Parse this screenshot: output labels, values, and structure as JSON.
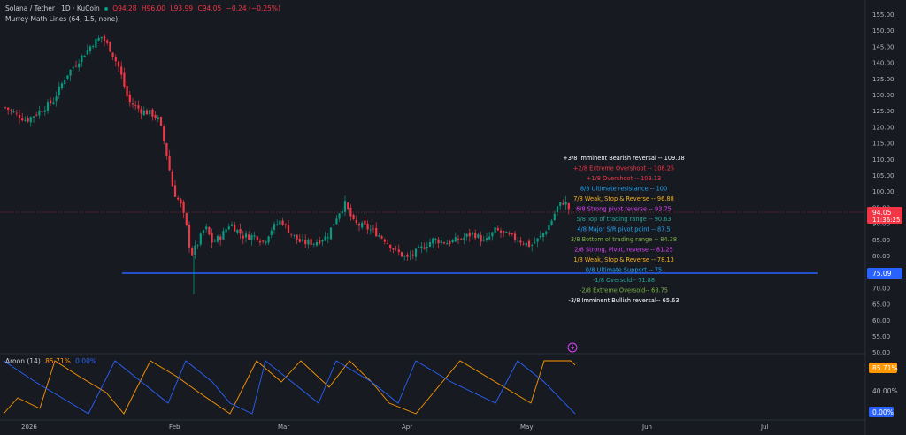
{
  "header": {
    "symbol": "Solana / Tether · 1D · KuCoin",
    "ohlc": {
      "o": "O94.28",
      "h": "H96.00",
      "l": "L93.99",
      "c": "C94.05",
      "change": "−0.24 (−0.25%)"
    },
    "indicator": "Murrey Math Lines (64, 1.5, none)"
  },
  "price_axis": {
    "labels": [
      "155.00",
      "150.00",
      "145.00",
      "140.00",
      "135.00",
      "130.00",
      "125.00",
      "120.00",
      "115.00",
      "110.00",
      "105.00",
      "100.00",
      "95.00",
      "90.00",
      "85.00",
      "80.00",
      "75.00",
      "70.00",
      "65.00",
      "60.00",
      "55.00",
      "50.00"
    ],
    "current_price": "94.05",
    "countdown": "11:36:25",
    "support_label": "75.09"
  },
  "time_axis": {
    "labels": [
      "2026",
      "Feb",
      "Mar",
      "Apr",
      "May",
      "Jun",
      "Jul"
    ]
  },
  "murrey_lines": [
    {
      "text": "+3/8 Imminent Bearish reversal --  109.38",
      "color": "#ffffff"
    },
    {
      "text": "+2/8 Extreme Overshoot --  106.25",
      "color": "#f23645"
    },
    {
      "text": "+1/8 Overshoot --  103.13",
      "color": "#f23645"
    },
    {
      "text": "8/8 Ultimate resistance --  100",
      "color": "#22a6f2"
    },
    {
      "text": "7/8 Weak, Stop & Reverse --  96.88",
      "color": "#f7b21e"
    },
    {
      "text": "6/8 Strong pivot reverse --  93.75",
      "color": "#e040fb"
    },
    {
      "text": "5/8 Top of trading range --  90.63",
      "color": "#26a69a"
    },
    {
      "text": "4/8 Major S/R pivot point --  87.5",
      "color": "#22a6f2"
    },
    {
      "text": "3/8 Bottom of trading range --  84.38",
      "color": "#7cb342"
    },
    {
      "text": "2/8 Strong, Pivot, reverse --  81.25",
      "color": "#e040fb"
    },
    {
      "text": "1/8 Weak, Stop & Reverse --  78.13",
      "color": "#f7b21e"
    },
    {
      "text": "0/8 Ultimate Support --  75",
      "color": "#22a6f2"
    },
    {
      "text": "-1/8 Oversold--  71.88",
      "color": "#26a69a"
    },
    {
      "text": "-2/8 Extreme Oversold--  68.75",
      "color": "#7cb342"
    },
    {
      "text": "-3/8 Imminent Bullish reversal--  65.63",
      "color": "#ffffff"
    }
  ],
  "aroon": {
    "title": "Aroon (14)",
    "up_value": "85.71%",
    "down_value": "0.00%",
    "axis_label": "40.00%",
    "up_color": "#ff9800",
    "down_color": "#2962ff"
  },
  "colors": {
    "up": "#089981",
    "down": "#f23645",
    "support_line": "#2962ff",
    "price_line": "#f23645"
  }
}
